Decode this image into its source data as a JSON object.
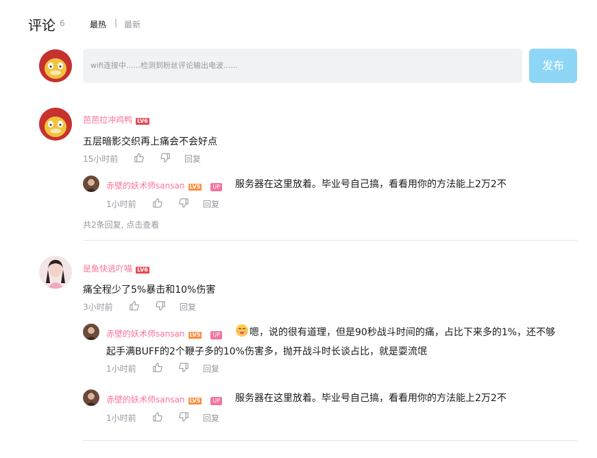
{
  "header": {
    "title": "评论",
    "count": "6",
    "sort_hot": "最热",
    "sort_sep": "|",
    "sort_new": "最新"
  },
  "composer": {
    "placeholder": "wifi连接中......检测到粉丝评论输出电波......",
    "publish_label": "发布"
  },
  "colors": {
    "username": "#fb7299",
    "publish_bg": "#8ed6f6",
    "level6": "#e84b55",
    "level5": "#ff8b3d",
    "up_badge": "#f3749d"
  },
  "icons": [
    "thumbs-up-icon",
    "thumbs-down-icon",
    "emoji-icon"
  ],
  "comments": [
    {
      "user": "芭芭拉冲鸡鸭",
      "level": "LV6",
      "content": "五层暗影交织再上痛会不会好点",
      "time": "15小时前",
      "reply_label": "回复",
      "replies": [
        {
          "user": "赤壁的妖术师sansan",
          "level": "LV5",
          "badge": "UP",
          "content": "服务器在这里放着。毕业号自己搞，看看用你的方法能上2万2不",
          "time": "1小时前",
          "reply_label": "回复"
        }
      ],
      "more_replies": "共2条回复, 点击查看"
    },
    {
      "user": "是鱼快逃吖喵",
      "level": "LV6",
      "content": "痛全程少了5%暴击和10%伤害",
      "time": "3小时前",
      "reply_label": "回复",
      "replies": [
        {
          "user": "赤壁的妖术师sansan",
          "level": "LV5",
          "badge": "UP",
          "content_line1": "嗯，说的很有道理，但是90秒战斗时间的痛，占比下来多的1%，还不够",
          "content_line2": "起手满BUFF的2个鞭子多的10%伤害多，抛开战斗时长谈占比，就是耍流氓",
          "time": "1小时前",
          "reply_label": "回复"
        },
        {
          "user": "赤壁的妖术师sansan",
          "level": "LV5",
          "badge": "UP",
          "content": "服务器在这里放着。毕业号自己搞，看看用你的方法能上2万2不",
          "time": "1小时前",
          "reply_label": "回复"
        }
      ]
    }
  ]
}
